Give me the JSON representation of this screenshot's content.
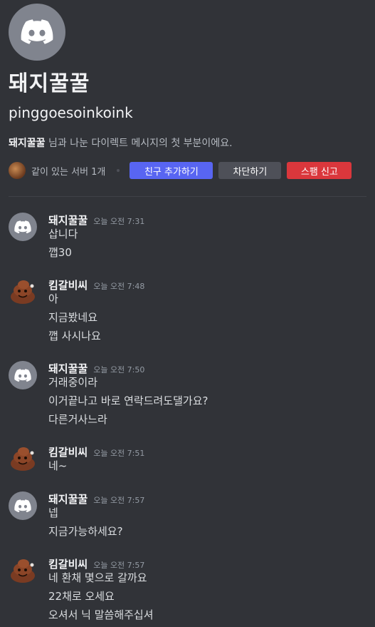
{
  "header": {
    "title": "돼지꿀꿀",
    "username": "pinggoesoinkoink",
    "intro_name": "돼지꿀꿀",
    "intro_rest": " 님과 나눈 다이렉트 메시지의 첫 부분이에요.",
    "mutual_servers": "같이 있는 서버 1개",
    "add_friend": "친구 추가하기",
    "block": "차단하기",
    "report_spam": "스팸 신고"
  },
  "colors": {
    "background": "#313338",
    "blurple": "#5865f2",
    "danger": "#da373c",
    "secondary": "#4e5058"
  },
  "messages": [
    {
      "author": "돼지꿀꿀",
      "time": "오늘 오전 7:31",
      "avatar": "discord-logo-icon",
      "lines": [
        "삽니다",
        "깹30"
      ]
    },
    {
      "author": "킴갈비씨",
      "time": "오늘 오전 7:48",
      "avatar": "poop-character-icon",
      "lines": [
        "아",
        "지금봤네요",
        "깹 사시나요"
      ]
    },
    {
      "author": "돼지꿀꿀",
      "time": "오늘 오전 7:50",
      "avatar": "discord-logo-icon",
      "lines": [
        "거래중이라",
        "이거끝나고 바로 연락드려도댈가요?",
        "다른거사느라"
      ]
    },
    {
      "author": "킴갈비씨",
      "time": "오늘 오전 7:51",
      "avatar": "poop-character-icon",
      "lines": [
        "네~"
      ]
    },
    {
      "author": "돼지꿀꿀",
      "time": "오늘 오전 7:57",
      "avatar": "discord-logo-icon",
      "lines": [
        "넵",
        "지금가능하세요?"
      ]
    },
    {
      "author": "킴갈비씨",
      "time": "오늘 오전 7:57",
      "avatar": "poop-character-icon",
      "lines": [
        "네 환채 몇으로 갈까요",
        "22채로 오세요",
        "오셔서 닉 말씀해주십셔"
      ]
    }
  ]
}
